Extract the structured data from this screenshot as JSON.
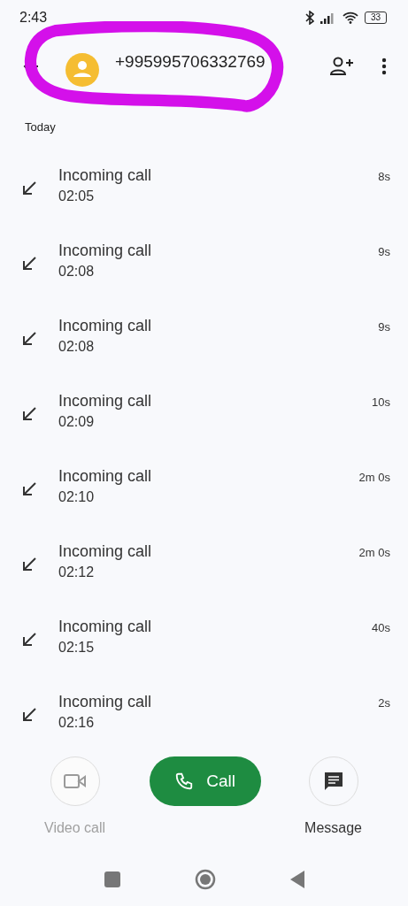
{
  "status_bar": {
    "time": "2:43",
    "battery": "33"
  },
  "header": {
    "title": "+995995706332769"
  },
  "section": "Today",
  "calls": [
    {
      "kind": "incoming",
      "label": "Incoming call",
      "time": "02:05",
      "duration": "8s"
    },
    {
      "kind": "incoming",
      "label": "Incoming call",
      "time": "02:08",
      "duration": "9s"
    },
    {
      "kind": "incoming",
      "label": "Incoming call",
      "time": "02:08",
      "duration": "9s"
    },
    {
      "kind": "incoming",
      "label": "Incoming call",
      "time": "02:09",
      "duration": "10s"
    },
    {
      "kind": "incoming",
      "label": "Incoming call",
      "time": "02:10",
      "duration": "2m 0s"
    },
    {
      "kind": "incoming",
      "label": "Incoming call",
      "time": "02:12",
      "duration": "2m 0s"
    },
    {
      "kind": "incoming",
      "label": "Incoming call",
      "time": "02:15",
      "duration": "40s"
    },
    {
      "kind": "incoming",
      "label": "Incoming call",
      "time": "02:16",
      "duration": "2s"
    }
  ],
  "actions": {
    "video": {
      "label": "Video call",
      "disabled": true
    },
    "call": {
      "label": "Call"
    },
    "message": {
      "label": "Message"
    }
  }
}
